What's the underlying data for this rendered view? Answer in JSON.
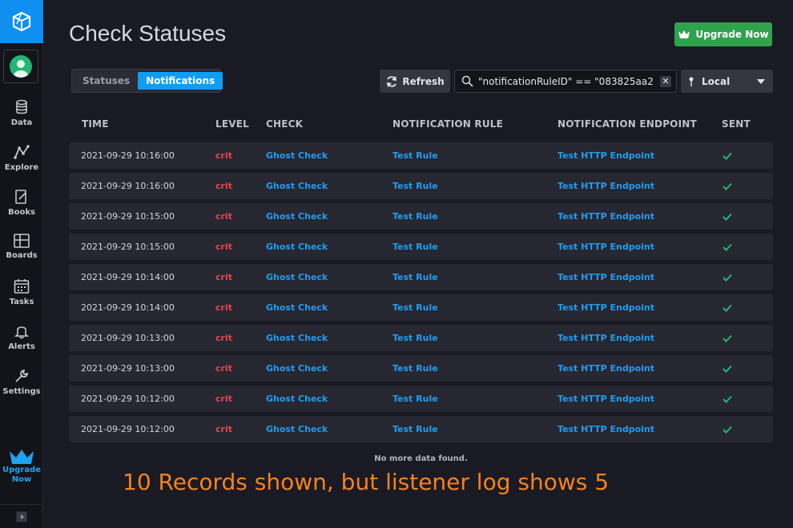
{
  "page": {
    "title": "Check Statuses",
    "upgrade_button": "Upgrade Now"
  },
  "sidebar": {
    "items": [
      {
        "label": "Data",
        "icon": "database-icon"
      },
      {
        "label": "Explore",
        "icon": "graph-icon"
      },
      {
        "label": "Books",
        "icon": "notebook-icon"
      },
      {
        "label": "Boards",
        "icon": "dashboard-icon"
      },
      {
        "label": "Tasks",
        "icon": "calendar-icon"
      },
      {
        "label": "Alerts",
        "icon": "bell-icon"
      },
      {
        "label": "Settings",
        "icon": "wrench-icon"
      }
    ],
    "upgrade_line1": "Upgrade",
    "upgrade_line2": "Now"
  },
  "toolbar": {
    "tabs": [
      {
        "label": "Statuses",
        "active": false
      },
      {
        "label": "Notifications",
        "active": true
      }
    ],
    "refresh_label": "Refresh",
    "search_value": "\"notificationRuleID\" == \"083825aa2",
    "timezone": "Local"
  },
  "table": {
    "columns": [
      "TIME",
      "LEVEL",
      "CHECK",
      "NOTIFICATION RULE",
      "NOTIFICATION ENDPOINT",
      "SENT"
    ],
    "rows": [
      {
        "time": "2021-09-29 10:16:00",
        "level": "crit",
        "check": "Ghost Check",
        "rule": "Test Rule",
        "endpoint": "Test HTTP Endpoint",
        "sent": true
      },
      {
        "time": "2021-09-29 10:16:00",
        "level": "crit",
        "check": "Ghost Check",
        "rule": "Test Rule",
        "endpoint": "Test HTTP Endpoint",
        "sent": true
      },
      {
        "time": "2021-09-29 10:15:00",
        "level": "crit",
        "check": "Ghost Check",
        "rule": "Test Rule",
        "endpoint": "Test HTTP Endpoint",
        "sent": true
      },
      {
        "time": "2021-09-29 10:15:00",
        "level": "crit",
        "check": "Ghost Check",
        "rule": "Test Rule",
        "endpoint": "Test HTTP Endpoint",
        "sent": true
      },
      {
        "time": "2021-09-29 10:14:00",
        "level": "crit",
        "check": "Ghost Check",
        "rule": "Test Rule",
        "endpoint": "Test HTTP Endpoint",
        "sent": true
      },
      {
        "time": "2021-09-29 10:14:00",
        "level": "crit",
        "check": "Ghost Check",
        "rule": "Test Rule",
        "endpoint": "Test HTTP Endpoint",
        "sent": true
      },
      {
        "time": "2021-09-29 10:13:00",
        "level": "crit",
        "check": "Ghost Check",
        "rule": "Test Rule",
        "endpoint": "Test HTTP Endpoint",
        "sent": true
      },
      {
        "time": "2021-09-29 10:13:00",
        "level": "crit",
        "check": "Ghost Check",
        "rule": "Test Rule",
        "endpoint": "Test HTTP Endpoint",
        "sent": true
      },
      {
        "time": "2021-09-29 10:12:00",
        "level": "crit",
        "check": "Ghost Check",
        "rule": "Test Rule",
        "endpoint": "Test HTTP Endpoint",
        "sent": true
      },
      {
        "time": "2021-09-29 10:12:00",
        "level": "crit",
        "check": "Ghost Check",
        "rule": "Test Rule",
        "endpoint": "Test HTTP Endpoint",
        "sent": true
      }
    ],
    "footer": "No more data found."
  },
  "annotation": "10 Records shown, but listener log shows 5",
  "colors": {
    "accent": "#109ef5",
    "crit": "#e0454f",
    "sent_check": "#22b573",
    "upgrade_green": "#30a24e",
    "annotation_orange": "#f5821f"
  }
}
